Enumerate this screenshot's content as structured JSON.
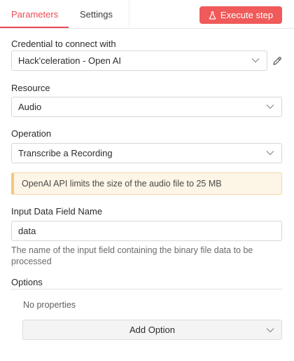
{
  "header": {
    "tabs": [
      {
        "label": "Parameters",
        "active": true
      },
      {
        "label": "Settings",
        "active": false
      }
    ],
    "execute_label": "Execute step",
    "accent_color": "#ea4b55",
    "button_color": "#f05a5a"
  },
  "credential": {
    "label": "Credential to connect with",
    "value": "Hack'celeration - Open AI"
  },
  "resource": {
    "label": "Resource",
    "value": "Audio"
  },
  "operation": {
    "label": "Operation",
    "value": "Transcribe a Recording"
  },
  "notice": {
    "text": "OpenAI API limits the size of the audio file to 25 MB",
    "color": "#fdf5e6"
  },
  "input_field": {
    "label": "Input Data Field Name",
    "value": "data",
    "hint": "The name of the input field containing the binary file data to be processed"
  },
  "options": {
    "label": "Options",
    "empty_text": "No properties",
    "add_label": "Add Option"
  }
}
